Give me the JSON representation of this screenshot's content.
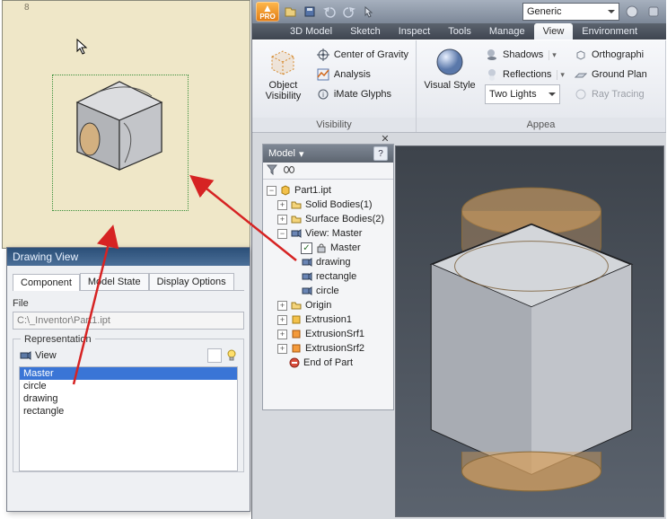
{
  "sheet": {
    "ruler_tick": "8"
  },
  "dialog": {
    "title": "Drawing View",
    "tabs": [
      "Component",
      "Model State",
      "Display Options"
    ],
    "file_label": "File",
    "file_value": "C:\\_Inventor\\Part1.ipt",
    "rep_legend": "Representation",
    "view_label": "View",
    "list": [
      "Master",
      "circle",
      "drawing",
      "rectangle"
    ],
    "selected": "Master"
  },
  "app": {
    "pro": "PRO",
    "material": "Generic",
    "tabs": [
      "3D Model",
      "Sketch",
      "Inspect",
      "Tools",
      "Manage",
      "View",
      "Environment"
    ],
    "active_tab_index": 5,
    "vis_panel_title": "Visibility",
    "appe_panel_title": "Appea",
    "object_visibility": "Object Visibility",
    "cog": "Center of Gravity",
    "analysis": "Analysis",
    "imate": "iMate Glyphs",
    "visual_style": "Visual Style",
    "shadows": "Shadows",
    "reflections": "Reflections",
    "lights_value": "Two Lights",
    "orthographi": "Orthographi",
    "ground_plan": "Ground Plan",
    "ray_tracing": "Ray Tracing"
  },
  "browser": {
    "title": "Model",
    "nodes": {
      "part": "Part1.ipt",
      "solid": "Solid Bodies(1)",
      "surface": "Surface Bodies(2)",
      "view_master": "View: Master",
      "master": "Master",
      "drawing": "drawing",
      "rectangle": "rectangle",
      "circle": "circle",
      "origin": "Origin",
      "ext1": "Extrusion1",
      "srf1": "ExtrusionSrf1",
      "srf2": "ExtrusionSrf2",
      "end": "End of Part"
    }
  }
}
